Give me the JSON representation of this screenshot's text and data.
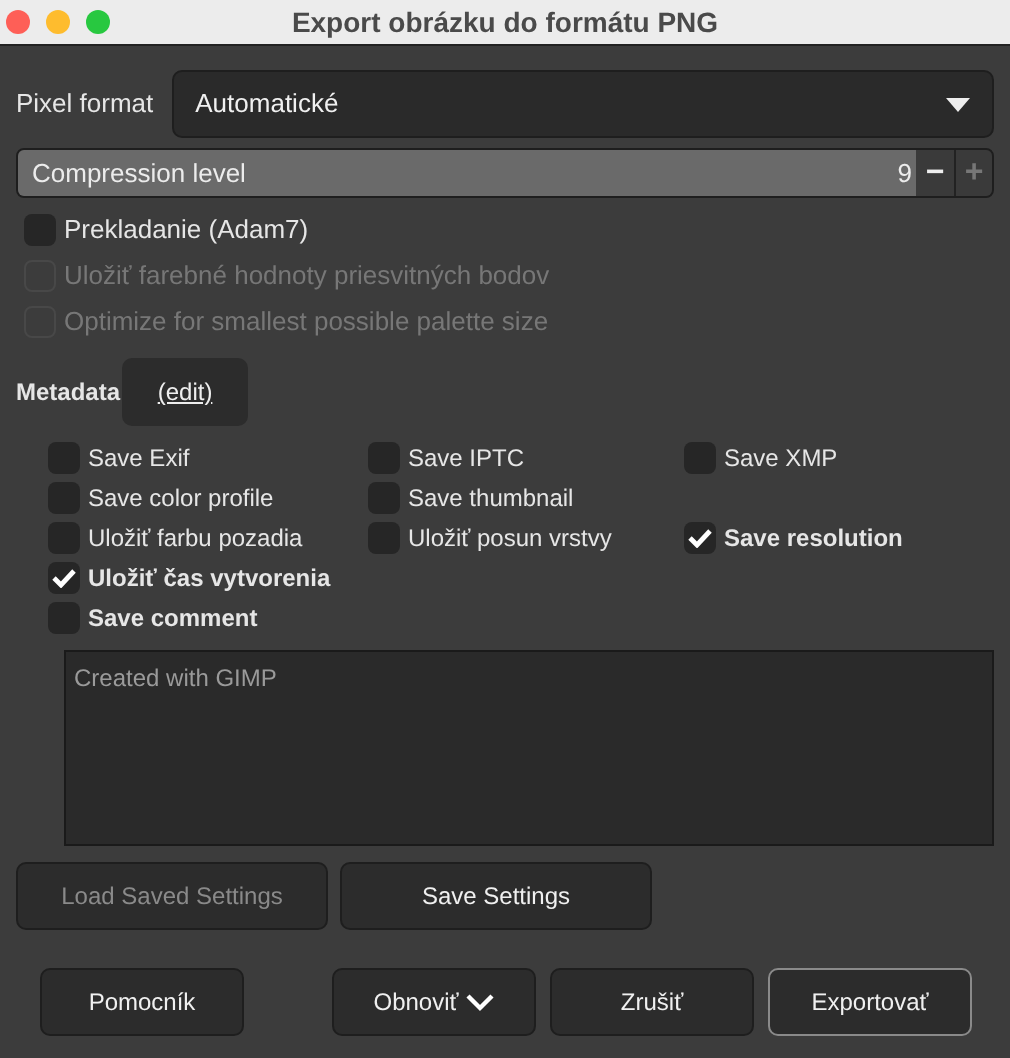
{
  "window": {
    "title": "Export obrázku do formátu PNG"
  },
  "pixel_format": {
    "label": "Pixel format",
    "value": "Automatické"
  },
  "compression": {
    "label": "Compression level",
    "value": "9",
    "minus": "−",
    "plus": "+"
  },
  "options": [
    {
      "label": "Prekladanie (Adam7)",
      "checked": false,
      "disabled": false
    },
    {
      "label": "Uložiť farebné hodnoty priesvitných bodov",
      "checked": false,
      "disabled": true
    },
    {
      "label": "Optimize for smallest possible palette size",
      "checked": false,
      "disabled": true
    }
  ],
  "metadata": {
    "label": "Metadata",
    "edit": "(edit)",
    "rows": [
      [
        {
          "label": "Save Exif",
          "checked": false,
          "bold": false
        },
        {
          "label": "Save IPTC",
          "checked": false,
          "bold": false
        },
        {
          "label": "Save XMP",
          "checked": false,
          "bold": false
        }
      ],
      [
        {
          "label": "Save color profile",
          "checked": false,
          "bold": false
        },
        {
          "label": "Save thumbnail",
          "checked": false,
          "bold": false
        }
      ],
      [
        {
          "label": "Uložiť farbu pozadia",
          "checked": false,
          "bold": false
        },
        {
          "label": "Uložiť posun vrstvy",
          "checked": false,
          "bold": false
        },
        {
          "label": "Save resolution",
          "checked": true,
          "bold": true
        }
      ],
      [
        {
          "label": "Uložiť čas vytvorenia",
          "checked": true,
          "bold": true
        }
      ],
      [
        {
          "label": "Save comment",
          "checked": false,
          "bold": true
        }
      ]
    ],
    "comment": "Created with GIMP"
  },
  "settings_buttons": [
    {
      "label": "Load Saved Settings",
      "disabled": true
    },
    {
      "label": "Save Settings",
      "disabled": false
    }
  ],
  "dialog_buttons": [
    {
      "label": "Pomocník",
      "kind": "plain"
    },
    {
      "label": "Obnoviť",
      "kind": "menu"
    },
    {
      "label": "Zrušiť",
      "kind": "plain"
    },
    {
      "label": "Exportovať",
      "kind": "default"
    }
  ]
}
